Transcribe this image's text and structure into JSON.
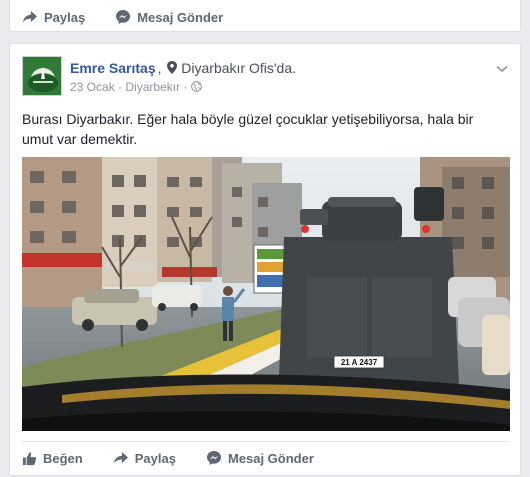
{
  "top_card": {
    "actions": {
      "share_label": "Paylaş",
      "message_label": "Mesaj Gönder"
    }
  },
  "post": {
    "author": "Emre Sarıtaş",
    "location_separator": ",",
    "location": "Diyarbakır Ofis'da.",
    "meta": {
      "date": "23 Ocak",
      "dot": "·",
      "place": "Diyarbekır",
      "dot2": "·"
    },
    "text": "Burası Diyarbakır. Eğer hala böyle güzel çocuklar yetişebiliyorsa, hala bir umut var demektir.",
    "photo": {
      "license_plate": "21 A 2437"
    },
    "actions": {
      "like_label": "Beğen",
      "share_label": "Paylaş",
      "message_label": "Mesaj Gönder"
    }
  },
  "colors": {
    "link": "#365899",
    "action_text": "#616770",
    "background": "#e9ebee"
  }
}
